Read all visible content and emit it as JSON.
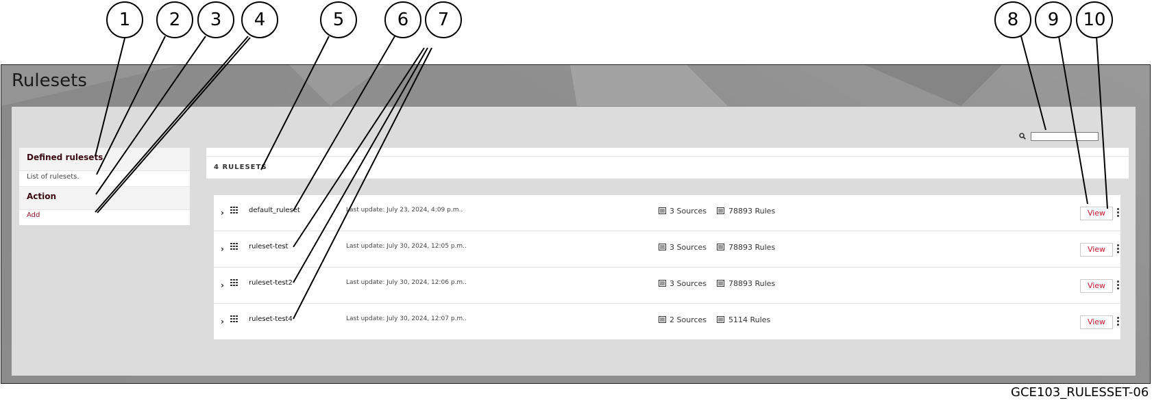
{
  "page_title": "Rulesets",
  "sidebar": {
    "sections": [
      {
        "heading": "Defined rulesets",
        "content": "List of rulesets."
      },
      {
        "heading": "Action",
        "link": "Add"
      }
    ]
  },
  "search": {
    "value": "",
    "icon": "search-icon"
  },
  "count_label": "4 RULESETS",
  "rulesets": [
    {
      "name": "default_ruleset",
      "last_update": "Last update: July 23, 2024, 4:09 p.m..",
      "sources_count": "3",
      "sources_label": "Sources",
      "rules_count": "78893",
      "rules_label": "Rules",
      "view_label": "View"
    },
    {
      "name": "ruleset-test",
      "last_update": "Last update: July 30, 2024, 12:05 p.m..",
      "sources_count": "3",
      "sources_label": "Sources",
      "rules_count": "78893",
      "rules_label": "Rules",
      "view_label": "View"
    },
    {
      "name": "ruleset-test2",
      "last_update": "Last update: July 30, 2024, 12:06 p.m..",
      "sources_count": "3",
      "sources_label": "Sources",
      "rules_count": "78893",
      "rules_label": "Rules",
      "view_label": "View"
    },
    {
      "name": "ruleset-test4",
      "last_update": "Last update: July 30, 2024, 12:07 p.m..",
      "sources_count": "2",
      "sources_label": "Sources",
      "rules_count": "5114",
      "rules_label": "Rules",
      "view_label": "View"
    }
  ],
  "callouts": [
    "1",
    "2",
    "3",
    "4",
    "5",
    "6",
    "7",
    "8",
    "9",
    "10"
  ],
  "document_id": "GCE103_RULESSET-06",
  "colors": {
    "accent": "#c4162f",
    "link": "#8a0f26",
    "frame_bg": "#8e8e8e",
    "panel_bg": "#dcdcdc"
  }
}
